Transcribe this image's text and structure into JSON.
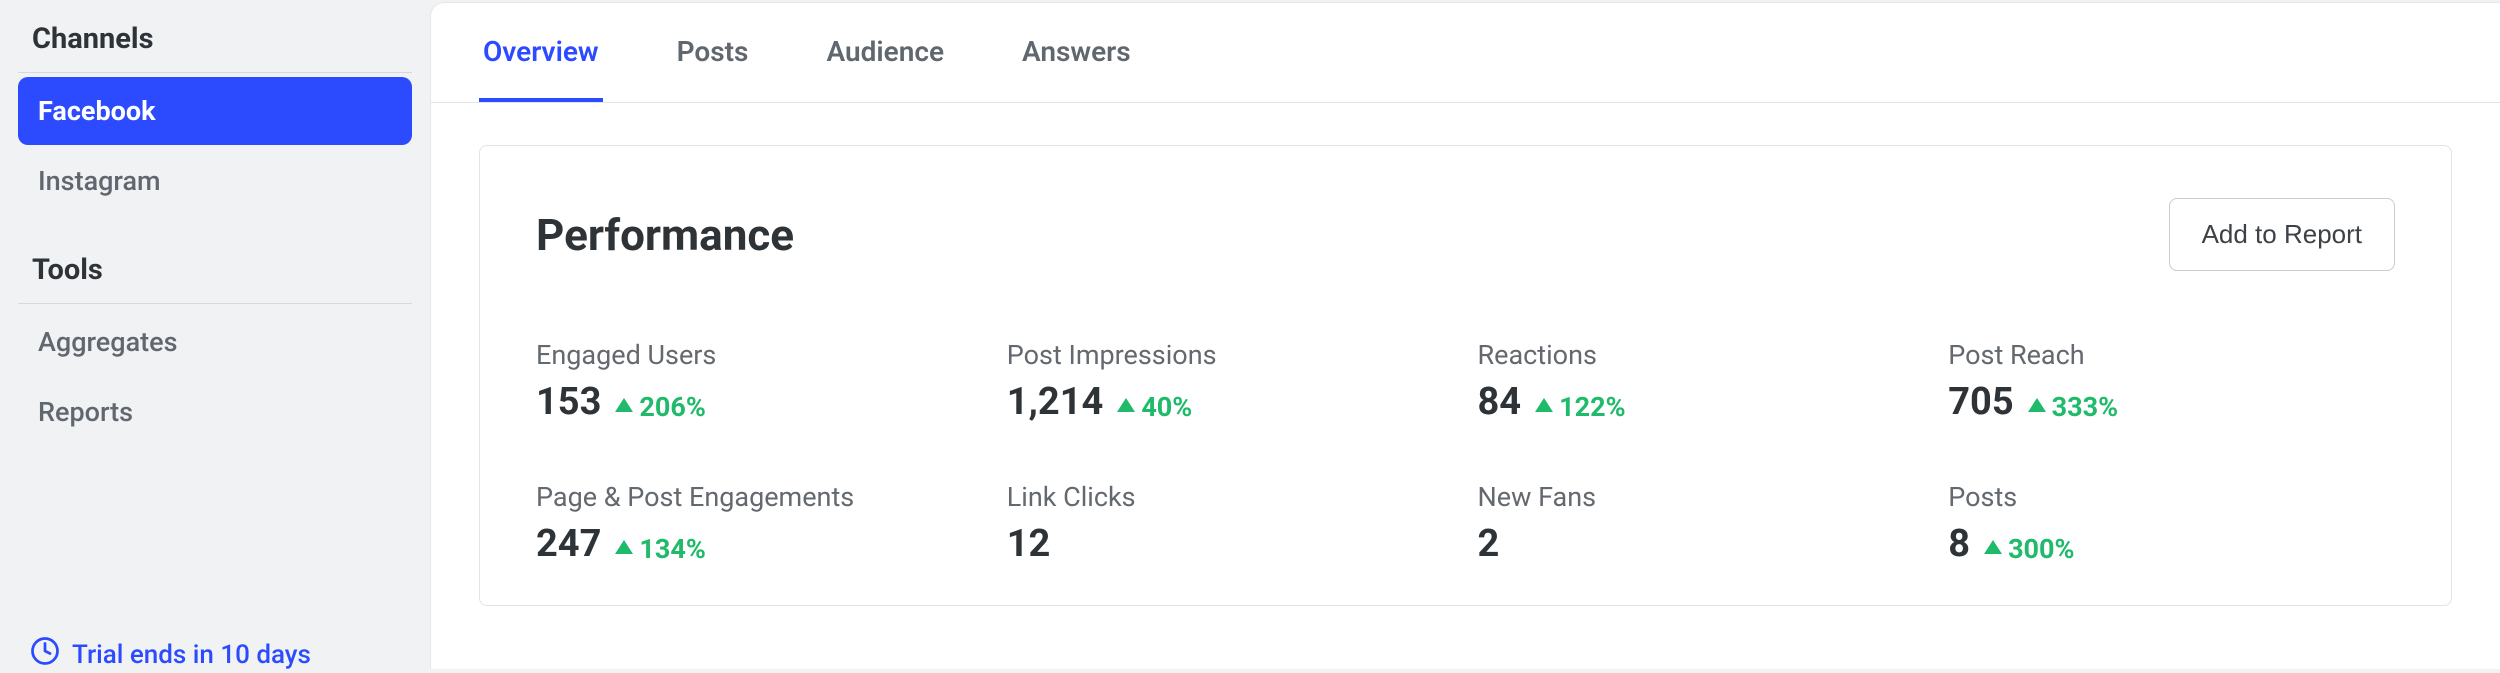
{
  "sidebar": {
    "sections": [
      {
        "title": "Channels",
        "items": [
          {
            "label": "Facebook",
            "active": true
          },
          {
            "label": "Instagram",
            "active": false
          }
        ]
      },
      {
        "title": "Tools",
        "items": [
          {
            "label": "Aggregates",
            "active": false
          },
          {
            "label": "Reports",
            "active": false
          }
        ]
      }
    ],
    "trial_notice": "Trial ends in 10 days"
  },
  "tabs": [
    {
      "label": "Overview",
      "active": true
    },
    {
      "label": "Posts",
      "active": false
    },
    {
      "label": "Audience",
      "active": false
    },
    {
      "label": "Answers",
      "active": false
    }
  ],
  "card": {
    "title": "Performance",
    "add_to_report_label": "Add to Report"
  },
  "metrics": [
    {
      "label": "Engaged Users",
      "value": "153",
      "delta": "206%",
      "has_delta": true
    },
    {
      "label": "Post Impressions",
      "value": "1,214",
      "delta": "40%",
      "has_delta": true
    },
    {
      "label": "Reactions",
      "value": "84",
      "delta": "122%",
      "has_delta": true
    },
    {
      "label": "Post Reach",
      "value": "705",
      "delta": "333%",
      "has_delta": true
    },
    {
      "label": "Page & Post Engagements",
      "value": "247",
      "delta": "134%",
      "has_delta": true
    },
    {
      "label": "Link Clicks",
      "value": "12",
      "delta": "",
      "has_delta": false
    },
    {
      "label": "New Fans",
      "value": "2",
      "delta": "",
      "has_delta": false
    },
    {
      "label": "Posts",
      "value": "8",
      "delta": "300%",
      "has_delta": true
    }
  ]
}
